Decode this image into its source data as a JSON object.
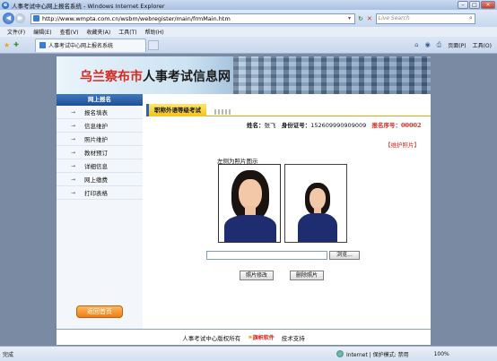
{
  "window": {
    "title": "人事考试中心网上报名系统 - Windows Internet Explorer",
    "min": "–",
    "max": "□",
    "close": "✕"
  },
  "address": {
    "url": "http://www.wmpta.com.cn/wsbm/webregister/main/frmMain.htm",
    "search_placeholder": "Live Search"
  },
  "menu": [
    "文件(F)",
    "编辑(E)",
    "查看(V)",
    "收藏夹(A)",
    "工具(T)",
    "帮助(H)"
  ],
  "tab": {
    "label": "人事考试中心网上报名系统"
  },
  "command_bar": {
    "page": "页面(P)",
    "tools": "工具(O)"
  },
  "site": {
    "title_red": "乌兰察布市",
    "title_black": "人事考试信息网"
  },
  "left_nav": {
    "header": "网上报名",
    "items": [
      "报名填表",
      "信息维护",
      "照片维护",
      "教材预订",
      "详细信息",
      "网上缴费",
      "打印表格"
    ],
    "back_home": "返回首页"
  },
  "main": {
    "exam_tab": "职称外语等级考试",
    "name_label": "姓名：",
    "name_value": "张飞",
    "id_label": "身份证号：",
    "id_value": "152609990909009",
    "reg_label": "报名序号：",
    "reg_value": "00002",
    "maintain_link": "【维护照片】",
    "photo_label": "左侧为照片图示",
    "browse": "浏览...",
    "modify_btn": "照片修改",
    "delete_btn": "删除照片"
  },
  "footer": {
    "copyright": "人事考试中心版权所有",
    "logo": "旗帜软件",
    "support": "技术支持"
  },
  "status": {
    "left": "完成",
    "zone": "Internet | 保护模式: 禁用",
    "zoom": "100%"
  }
}
